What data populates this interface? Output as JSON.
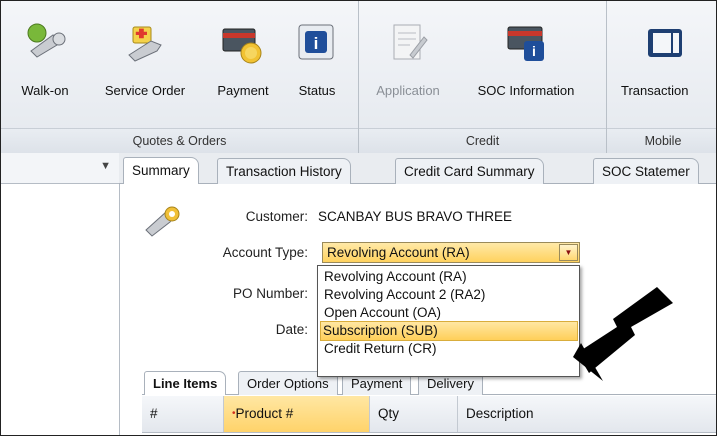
{
  "ribbon": {
    "groups": [
      {
        "title": "Quotes & Orders"
      },
      {
        "title": "Credit"
      },
      {
        "title": "Mobile"
      }
    ],
    "buttons": {
      "walk_on": "Walk-on",
      "service_order": "Service Order",
      "payment": "Payment",
      "status": "Status",
      "application": "Application",
      "soc_information": "SOC Information",
      "transactions": "Transaction"
    }
  },
  "tabs": [
    "Summary",
    "Transaction History",
    "Credit Card Summary",
    "SOC Statemer"
  ],
  "form": {
    "customer_label": "Customer:",
    "customer_value": "SCANBAY BUS BRAVO THREE",
    "account_type_label": "Account Type:",
    "account_type_value": "Revolving Account (RA)",
    "po_number_label": "PO Number:",
    "date_label": "Date:"
  },
  "dropdown_options": [
    "Revolving Account (RA)",
    "Revolving Account 2 (RA2)",
    "Open Account (OA)",
    "Subscription (SUB)",
    "Credit Return (CR)"
  ],
  "subtabs": [
    "Line Items",
    "Order Options",
    "Payment",
    "Delivery"
  ],
  "grid_columns": [
    "#",
    "Product #",
    "Qty",
    "Description"
  ],
  "colors": {
    "highlight": "#ffd25e",
    "arrow": "#000000"
  }
}
